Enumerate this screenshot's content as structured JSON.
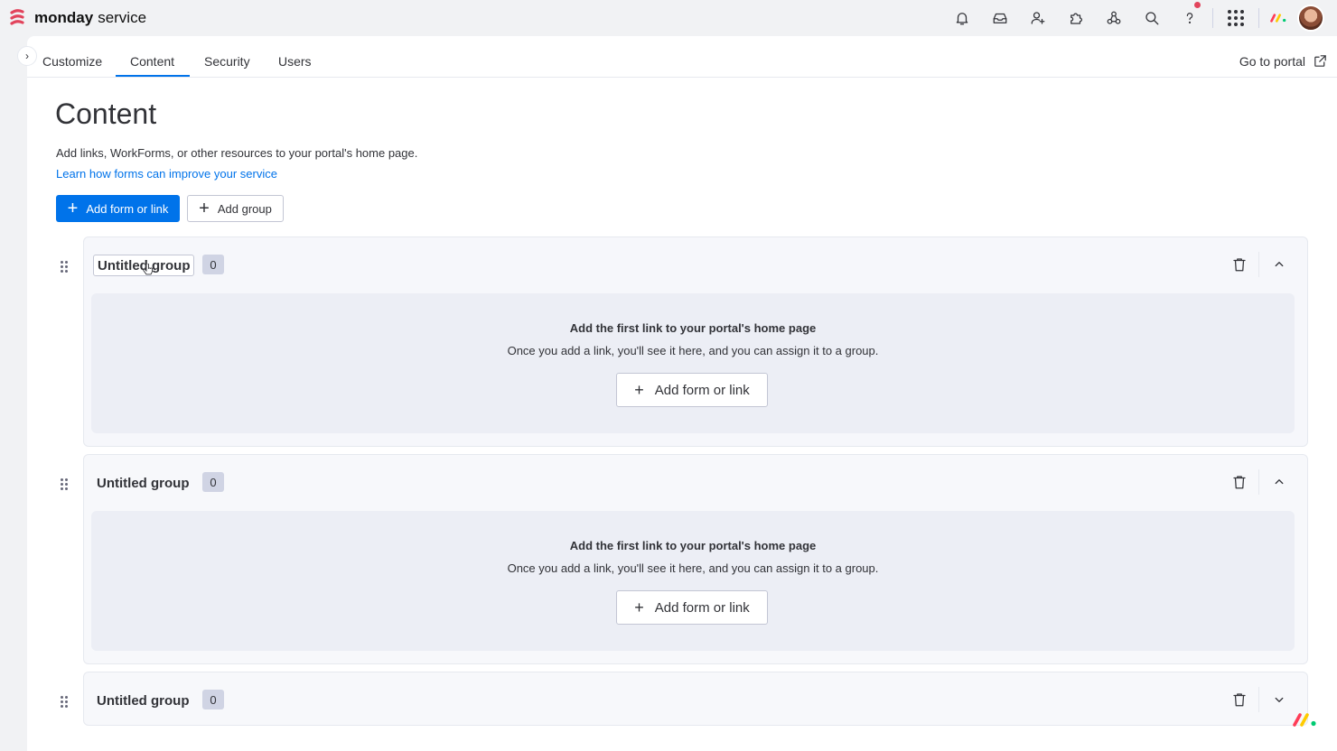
{
  "app": {
    "brand_name": "monday",
    "product_name": "service",
    "brand_color": "#e2445c"
  },
  "topbar": {
    "icons": [
      "bell-icon",
      "inbox-icon",
      "invite-user-icon",
      "apps-puzzle-icon",
      "integrations-icon",
      "search-icon",
      "help-icon",
      "app-grid-icon"
    ]
  },
  "tabs": [
    {
      "label": "Customize"
    },
    {
      "label": "Content",
      "active": true
    },
    {
      "label": "Security"
    },
    {
      "label": "Users"
    }
  ],
  "portal_link": {
    "label": "Go to portal"
  },
  "page": {
    "title": "Content",
    "description": "Add links, WorkForms, or other resources to your portal's home page.",
    "learn_link": "Learn how forms can improve your service"
  },
  "actions": {
    "add_form_label": "Add form or link",
    "add_group_label": "Add group"
  },
  "groups": [
    {
      "title": "Untitled group",
      "count": "0",
      "expanded": true,
      "empty_title": "Add the first link to your portal's home page",
      "empty_subtitle": "Once you add a link, you'll see it here, and you can assign it to a group.",
      "empty_button": "Add form or link"
    },
    {
      "title": "Untitled group",
      "count": "0",
      "expanded": true,
      "empty_title": "Add the first link to your portal's home page",
      "empty_subtitle": "Once you add a link, you'll see it here, and you can assign it to a group.",
      "empty_button": "Add form or link"
    },
    {
      "title": "Untitled group",
      "count": "0",
      "expanded": false
    }
  ],
  "colors": {
    "primary": "#0073ea",
    "text": "#323338"
  }
}
